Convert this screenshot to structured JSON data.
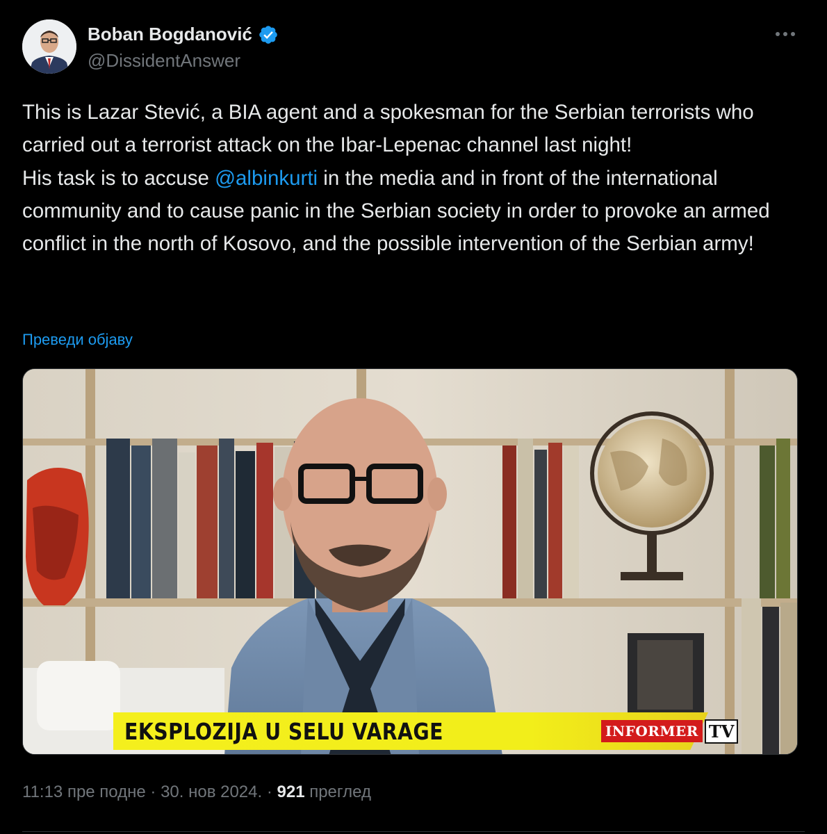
{
  "author": {
    "display_name": "Boban Bogdanović",
    "handle": "@DissidentAnswer"
  },
  "tweet": {
    "line1_text": "This is Lazar Stević, a BIA agent and a spokesman for the Serbian terrorists who carried out a terrorist attack on the Ibar-Lepenac channel last night!",
    "line2_before": "His task is to accuse ",
    "mention": "@albinkurti",
    "line2_after": " in the media and in front of the international community and to cause panic in the Serbian society in order to provoke an armed conflict in the north of Kosovo, and the possible intervention of the Serbian army!",
    "translate_label": "Преведи објаву"
  },
  "media": {
    "ticker_text": "EKSPLOZIJA U SELU VARAGE",
    "logo_text": "INFORMER",
    "logo_tv": "TV"
  },
  "meta": {
    "time": "11:13 пре подне",
    "separator1": " · ",
    "date": "30. нов 2024.",
    "separator2": " · ",
    "views_count": "921",
    "views_label": " преглед"
  },
  "colors": {
    "background": "#000000",
    "text": "#e7e9ea",
    "secondary": "#71767b",
    "link": "#1d9bf0"
  }
}
